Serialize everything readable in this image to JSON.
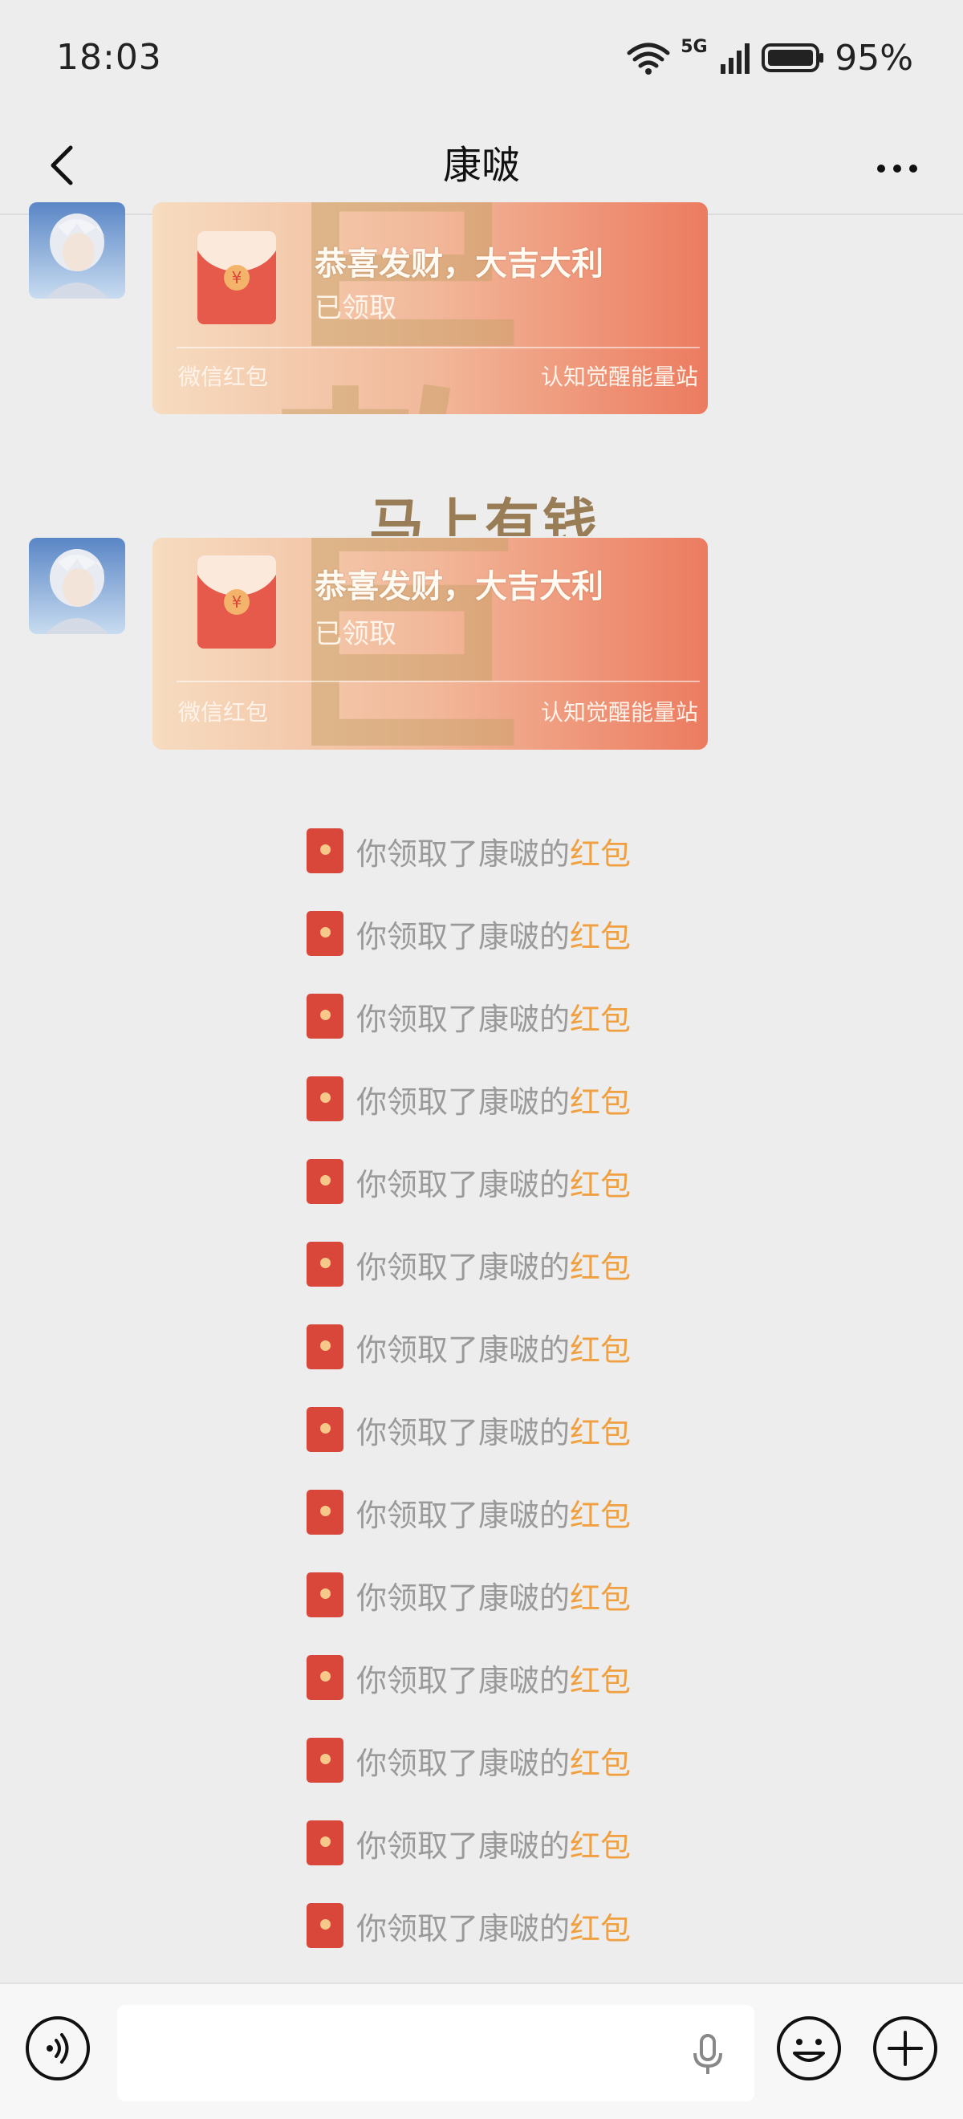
{
  "status_bar": {
    "time": "18:03",
    "network": "5G",
    "battery": "95%"
  },
  "header": {
    "title": "康啵",
    "back_icon": "chevron-left-icon",
    "more_icon": "ellipsis-icon"
  },
  "messages": [
    {
      "type": "red-packet",
      "title": "恭喜发财，大吉大利",
      "status": "已领取",
      "packet_type": "微信红包",
      "source": "认知觉醒能量站",
      "background_text": "巨款"
    },
    {
      "type": "red-packet",
      "title": "恭喜发财，大吉大利",
      "status": "已领取",
      "packet_type": "微信红包",
      "source": "认知觉醒能量站",
      "background_text": "巨款"
    }
  ],
  "decoration_text": "马上有钱",
  "notices": [
    {
      "text": "你领取了康啵的",
      "link": "红包"
    },
    {
      "text": "你领取了康啵的",
      "link": "红包"
    },
    {
      "text": "你领取了康啵的",
      "link": "红包"
    },
    {
      "text": "你领取了康啵的",
      "link": "红包"
    },
    {
      "text": "你领取了康啵的",
      "link": "红包"
    },
    {
      "text": "你领取了康啵的",
      "link": "红包"
    },
    {
      "text": "你领取了康啵的",
      "link": "红包"
    },
    {
      "text": "你领取了康啵的",
      "link": "红包"
    },
    {
      "text": "你领取了康啵的",
      "link": "红包"
    },
    {
      "text": "你领取了康啵的",
      "link": "红包"
    },
    {
      "text": "你领取了康啵的",
      "link": "红包"
    },
    {
      "text": "你领取了康啵的",
      "link": "红包"
    },
    {
      "text": "你领取了康啵的",
      "link": "红包"
    },
    {
      "text": "你领取了康啵的",
      "link": "红包"
    }
  ],
  "input_bar": {
    "value": "",
    "icons": [
      "voice-icon",
      "microphone-icon",
      "emoji-icon",
      "plus-icon"
    ]
  },
  "colors": {
    "background": "#ededed",
    "link": "#f0a040",
    "notice_text": "#9a9a9a",
    "red_packet": "#d9473a"
  }
}
